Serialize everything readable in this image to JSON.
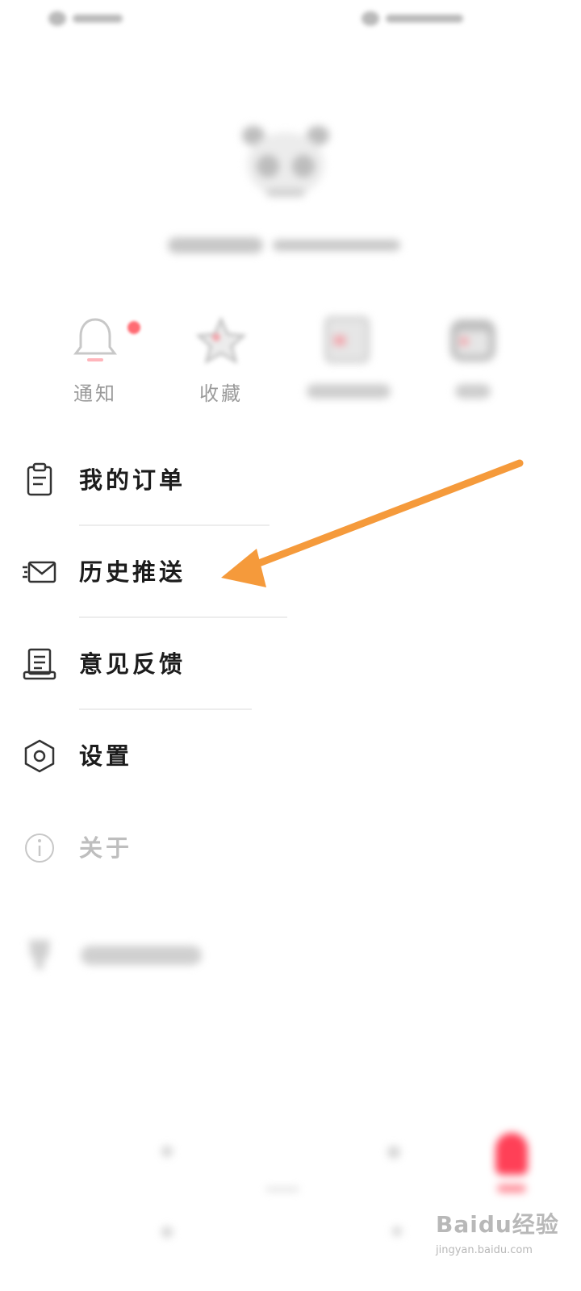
{
  "quick_actions": {
    "notifications_label": "通知",
    "favorites_label": "收藏"
  },
  "menu": {
    "items": [
      {
        "label": "我的订单",
        "icon": "clipboard-icon"
      },
      {
        "label": "历史推送",
        "icon": "envelope-icon"
      },
      {
        "label": "意见反馈",
        "icon": "feedback-icon"
      },
      {
        "label": "设置",
        "icon": "hexagon-settings-icon"
      },
      {
        "label": "关于",
        "icon": "info-icon"
      }
    ]
  },
  "annotation": {
    "arrow_color": "#f59a3b",
    "points_to": "历史推送"
  },
  "watermark": {
    "brand": "Baidu经验",
    "url": "jingyan.baidu.com"
  },
  "colors": {
    "accent": "#ff4057",
    "notification_dot": "#ff6b73",
    "text_primary": "#1c1c1c",
    "text_muted": "#9a9a9a"
  }
}
